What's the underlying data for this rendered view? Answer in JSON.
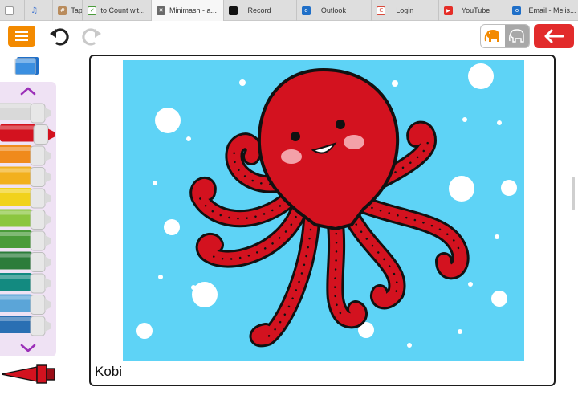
{
  "browser": {
    "tabs": [
      {
        "title": "",
        "favicon": "doc-icon"
      },
      {
        "title": "",
        "favicon": "music-icon"
      },
      {
        "title": "Tap",
        "favicon": "grid-icon"
      },
      {
        "title": "to Count wit...",
        "favicon": "check-icon"
      },
      {
        "title": "Minimash - a...",
        "favicon": "close-icon",
        "active": true
      },
      {
        "title": "Record",
        "favicon": "record-icon"
      },
      {
        "title": "Outlook",
        "favicon": "outlook-icon"
      },
      {
        "title": "Login",
        "favicon": "login-icon"
      },
      {
        "title": "YouTube",
        "favicon": "youtube-icon"
      },
      {
        "title": "Email - Melis...",
        "favicon": "outlook-icon"
      }
    ]
  },
  "toolbar": {
    "menu_icon": "hamburger-icon",
    "undo_icon": "undo-icon",
    "redo_icon": "redo-icon",
    "modes": [
      "elephant-color-icon",
      "elephant-outline-icon"
    ],
    "back_icon": "arrow-left-icon",
    "accent": "#f38a00",
    "back_color": "#e22b2b"
  },
  "palette": {
    "tools": [
      "eraser-icon",
      "chevron-up-icon",
      "chevron-down-icon",
      "pen-icon"
    ],
    "selected_color": "#d3121f",
    "markers": [
      "#d9d9d9",
      "#d3121f",
      "#f08a1c",
      "#f2b01e",
      "#f1d21c",
      "#8cc63f",
      "#4a9b3a",
      "#2c7c3a",
      "#138a80",
      "#5ba5d8",
      "#2a6fb3",
      "#6b3fa0",
      "#9b2fa0"
    ]
  },
  "canvas": {
    "background": "#5ed3f6",
    "subject": "#d3121f",
    "caption": "Kobi"
  }
}
